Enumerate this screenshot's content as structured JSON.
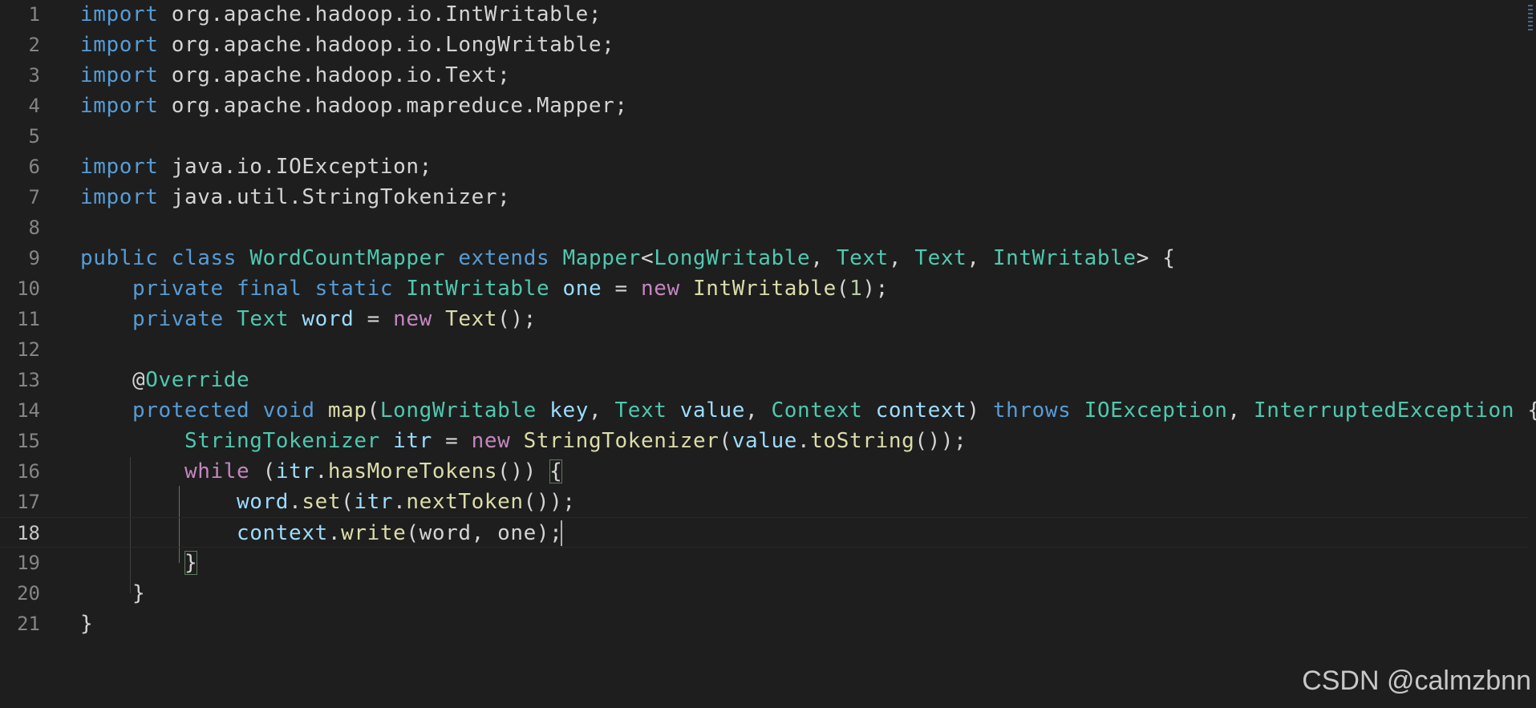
{
  "editor": {
    "current_line": 18,
    "lines": [
      {
        "n": "1",
        "tokens": [
          [
            "kw",
            "import"
          ],
          [
            "plain",
            " org.apache.hadoop.io.IntWritable;"
          ]
        ]
      },
      {
        "n": "2",
        "tokens": [
          [
            "kw",
            "import"
          ],
          [
            "plain",
            " org.apache.hadoop.io.LongWritable;"
          ]
        ]
      },
      {
        "n": "3",
        "tokens": [
          [
            "kw",
            "import"
          ],
          [
            "plain",
            " org.apache.hadoop.io.Text;"
          ]
        ]
      },
      {
        "n": "4",
        "tokens": [
          [
            "kw",
            "import"
          ],
          [
            "plain",
            " org.apache.hadoop.mapreduce.Mapper;"
          ]
        ]
      },
      {
        "n": "5",
        "tokens": []
      },
      {
        "n": "6",
        "tokens": [
          [
            "kw",
            "import"
          ],
          [
            "plain",
            " java.io.IOException;"
          ]
        ]
      },
      {
        "n": "7",
        "tokens": [
          [
            "kw",
            "import"
          ],
          [
            "plain",
            " java.util.StringTokenizer;"
          ]
        ]
      },
      {
        "n": "8",
        "tokens": []
      },
      {
        "n": "9",
        "tokens": [
          [
            "kw",
            "public"
          ],
          [
            "plain",
            " "
          ],
          [
            "kw",
            "class"
          ],
          [
            "plain",
            " "
          ],
          [
            "type",
            "WordCountMapper"
          ],
          [
            "plain",
            " "
          ],
          [
            "kw",
            "extends"
          ],
          [
            "plain",
            " "
          ],
          [
            "type",
            "Mapper"
          ],
          [
            "plain",
            "<"
          ],
          [
            "type",
            "LongWritable"
          ],
          [
            "plain",
            ", "
          ],
          [
            "type",
            "Text"
          ],
          [
            "plain",
            ", "
          ],
          [
            "type",
            "Text"
          ],
          [
            "plain",
            ", "
          ],
          [
            "type",
            "IntWritable"
          ],
          [
            "plain",
            "> {"
          ]
        ]
      },
      {
        "n": "10",
        "tokens": [
          [
            "plain",
            "    "
          ],
          [
            "kw",
            "private"
          ],
          [
            "plain",
            " "
          ],
          [
            "kw",
            "final"
          ],
          [
            "plain",
            " "
          ],
          [
            "kw",
            "static"
          ],
          [
            "plain",
            " "
          ],
          [
            "type",
            "IntWritable"
          ],
          [
            "plain",
            " "
          ],
          [
            "var",
            "one"
          ],
          [
            "plain",
            " = "
          ],
          [
            "ctl",
            "new"
          ],
          [
            "plain",
            " "
          ],
          [
            "fn",
            "IntWritable"
          ],
          [
            "plain",
            "("
          ],
          [
            "num",
            "1"
          ],
          [
            "plain",
            ");"
          ]
        ]
      },
      {
        "n": "11",
        "tokens": [
          [
            "plain",
            "    "
          ],
          [
            "kw",
            "private"
          ],
          [
            "plain",
            " "
          ],
          [
            "type",
            "Text"
          ],
          [
            "plain",
            " "
          ],
          [
            "var",
            "word"
          ],
          [
            "plain",
            " = "
          ],
          [
            "ctl",
            "new"
          ],
          [
            "plain",
            " "
          ],
          [
            "fn",
            "Text"
          ],
          [
            "plain",
            "();"
          ]
        ]
      },
      {
        "n": "12",
        "tokens": []
      },
      {
        "n": "13",
        "tokens": [
          [
            "plain",
            "    @"
          ],
          [
            "type",
            "Override"
          ]
        ]
      },
      {
        "n": "14",
        "tokens": [
          [
            "plain",
            "    "
          ],
          [
            "kw",
            "protected"
          ],
          [
            "plain",
            " "
          ],
          [
            "kw",
            "void"
          ],
          [
            "plain",
            " "
          ],
          [
            "fn",
            "map"
          ],
          [
            "plain",
            "("
          ],
          [
            "type",
            "LongWritable"
          ],
          [
            "plain",
            " "
          ],
          [
            "var",
            "key"
          ],
          [
            "plain",
            ", "
          ],
          [
            "type",
            "Text"
          ],
          [
            "plain",
            " "
          ],
          [
            "var",
            "value"
          ],
          [
            "plain",
            ", "
          ],
          [
            "type",
            "Context"
          ],
          [
            "plain",
            " "
          ],
          [
            "var",
            "context"
          ],
          [
            "plain",
            ") "
          ],
          [
            "kw",
            "throws"
          ],
          [
            "plain",
            " "
          ],
          [
            "type",
            "IOException"
          ],
          [
            "plain",
            ", "
          ],
          [
            "type",
            "InterruptedException"
          ],
          [
            "plain",
            " {"
          ]
        ]
      },
      {
        "n": "15",
        "tokens": [
          [
            "plain",
            "        "
          ],
          [
            "type",
            "StringTokenizer"
          ],
          [
            "plain",
            " "
          ],
          [
            "var",
            "itr"
          ],
          [
            "plain",
            " = "
          ],
          [
            "ctl",
            "new"
          ],
          [
            "plain",
            " "
          ],
          [
            "fn",
            "StringTokenizer"
          ],
          [
            "plain",
            "("
          ],
          [
            "var",
            "value"
          ],
          [
            "plain",
            "."
          ],
          [
            "fn",
            "toString"
          ],
          [
            "plain",
            "());"
          ]
        ]
      },
      {
        "n": "16",
        "tokens": [
          [
            "plain",
            "        "
          ],
          [
            "ctl",
            "while"
          ],
          [
            "plain",
            " ("
          ],
          [
            "var",
            "itr"
          ],
          [
            "plain",
            "."
          ],
          [
            "fn",
            "hasMoreTokens"
          ],
          [
            "plain",
            "()) "
          ],
          [
            "bracket",
            "{"
          ]
        ]
      },
      {
        "n": "17",
        "tokens": [
          [
            "plain",
            "            "
          ],
          [
            "var",
            "word"
          ],
          [
            "plain",
            "."
          ],
          [
            "fn",
            "set"
          ],
          [
            "plain",
            "("
          ],
          [
            "var",
            "itr"
          ],
          [
            "plain",
            "."
          ],
          [
            "fn",
            "nextToken"
          ],
          [
            "plain",
            "());"
          ]
        ]
      },
      {
        "n": "18",
        "tokens": [
          [
            "plain",
            "            "
          ],
          [
            "var",
            "context"
          ],
          [
            "plain",
            "."
          ],
          [
            "fn",
            "write"
          ],
          [
            "plain",
            "(word, one);  "
          ]
        ]
      },
      {
        "n": "19",
        "tokens": [
          [
            "plain",
            "        "
          ],
          [
            "bracket",
            "}"
          ]
        ]
      },
      {
        "n": "20",
        "tokens": [
          [
            "plain",
            "    }"
          ]
        ]
      },
      {
        "n": "21",
        "tokens": [
          [
            "plain",
            "}"
          ]
        ]
      }
    ]
  },
  "colors": {
    "background": "#1e1e1e",
    "keyword": "#569cd6",
    "control": "#c586c0",
    "type": "#4ec9b0",
    "variable": "#9cdcfe",
    "function": "#dcdcaa",
    "number": "#b5cea8",
    "text": "#d4d4d4"
  },
  "watermark": "CSDN @calmzbnn"
}
